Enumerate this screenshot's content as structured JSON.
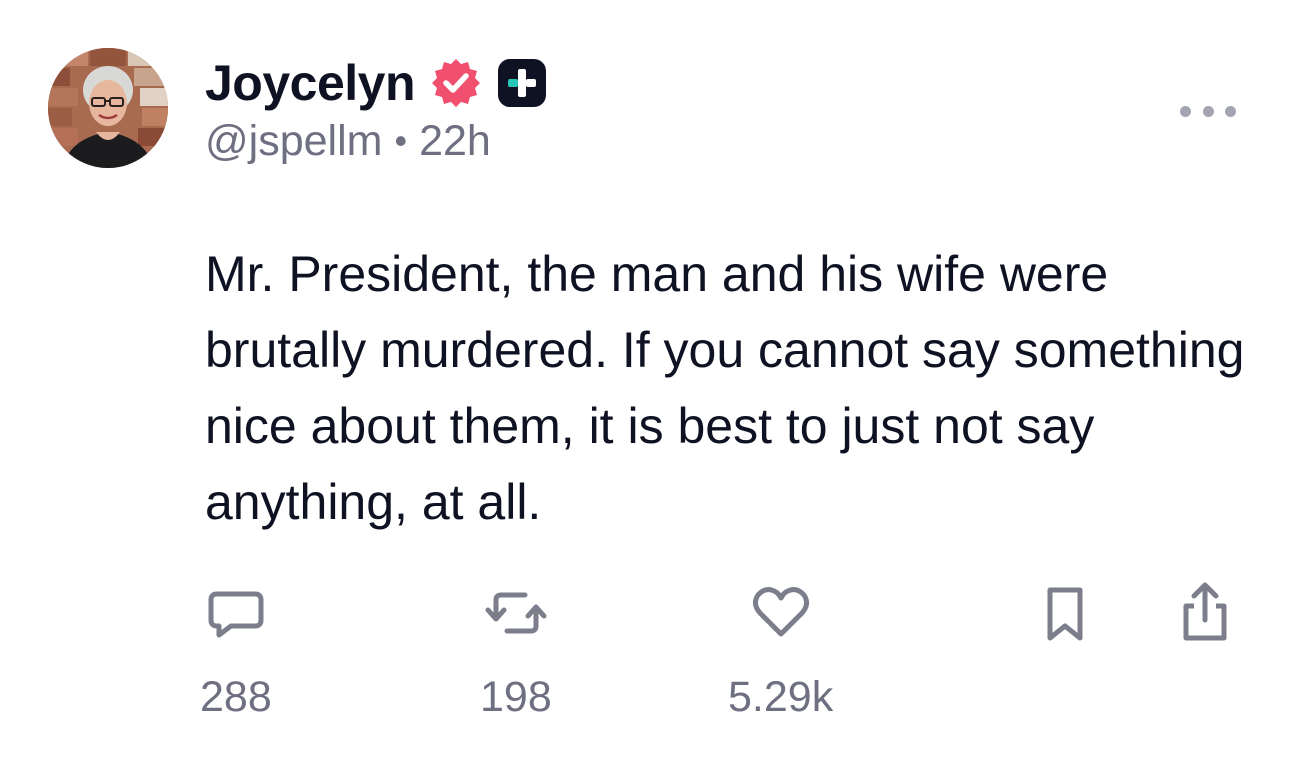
{
  "author": {
    "display_name": "Joycelyn",
    "handle": "@jspellm",
    "separator": "•",
    "time_ago": "22h",
    "verified_icon": "verified-badge-icon",
    "plus_icon": "plus-badge-icon"
  },
  "post": {
    "text": "Mr. President, the man and his wife were brutally murdered. If you cannot say something nice about them, it is best to just not say anything, at all."
  },
  "actions": {
    "reply_count": "288",
    "repost_count": "198",
    "like_count": "5.29k"
  },
  "colors": {
    "text": "#0f1222",
    "secondary": "#6e6f80",
    "verified": "#f0506e",
    "plus_badge": "#0f1222",
    "plus_accent": "#27c5b5"
  }
}
